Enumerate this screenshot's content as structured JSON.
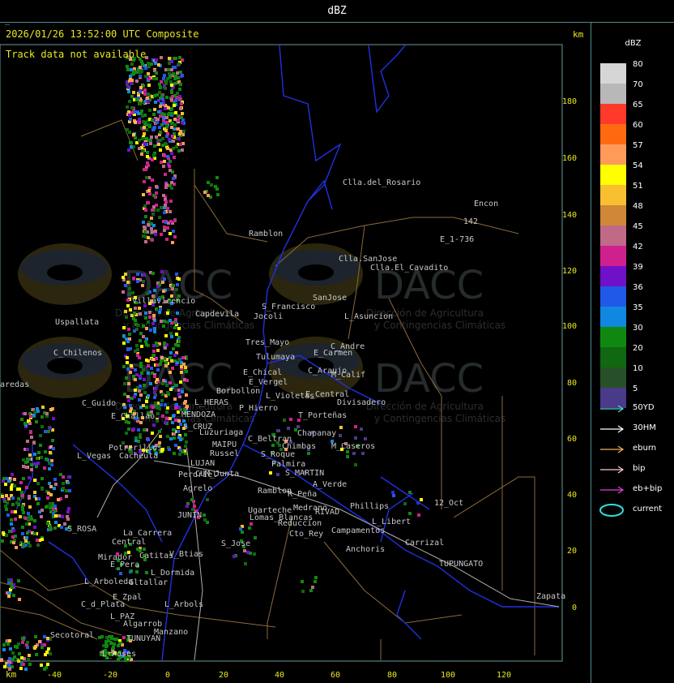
{
  "window": {
    "title": "dBZ"
  },
  "map": {
    "timestamp": "2026/01/26 13:52:00 UTC Composite",
    "track_notice": "Track data not available",
    "units_top": "km",
    "units_bottom": "km",
    "y_ticks": [
      "180",
      "160",
      "140",
      "120",
      "100",
      "80",
      "60",
      "40",
      "20",
      "0"
    ],
    "x_ticks": [
      "-40",
      "-20",
      "0",
      "20",
      "40",
      "60",
      "80",
      "100",
      "120"
    ],
    "watermark": {
      "brand": "DACC",
      "line1": "Dirección de Agricultura",
      "line2": "y Contingencias Climáticas"
    },
    "places": [
      "Clla.del_Rosario",
      "Encon",
      "142",
      "E_1-736",
      "Ramblon",
      "Clla.SanJose",
      "Clla.El_Cavadito",
      "Villavicencio",
      "Capdevila",
      "S_Francisco",
      "SanJose",
      "Uspallata",
      "L_Asuncion",
      "Jocoli",
      "Tres_Mayo",
      "E_Carmen",
      "C_Andre",
      "C_Chilenos",
      "Tulumaya",
      "C_Araujo",
      "M_Calif",
      "E_Chical",
      "E_Vergel",
      "Borbollon",
      "L_Violetas",
      "E_Central",
      "Divisadero",
      "aredas",
      "C_Guido",
      "L_HERAS",
      "P_Hierro",
      "E_Challao",
      "MENDOZA",
      "T_Porteñas",
      "S_CRUZ",
      "Luzuriaga",
      "C_Beltran",
      "Chapanay",
      "Potrerillos",
      "MAIPU",
      "Chimbas",
      "M_Caseros",
      "L_Vegas",
      "Cacheuta",
      "Russel",
      "S_Roque",
      "Palmira",
      "LUJAN",
      "CUM_Junta",
      "Perdriel",
      "S_MARTIN",
      "A_Verde",
      "Agrelo",
      "Ramblon",
      "R_Peña",
      "JUNIN",
      "Ugarteche",
      "Medrano",
      "RIVAD",
      "Phillips",
      "12_Oct",
      "Lomas_Blancas",
      "Reduccion",
      "L_Libert",
      "S_ROSA",
      "La_Carrera",
      "Cto_Rey",
      "Campamentos",
      "Central",
      "S_Jose",
      "Carrizal",
      "Catitas",
      "V_Btias",
      "Anchoris",
      "Mirador",
      "E_Pera",
      "TUPUNGATO",
      "L_Dormida",
      "L_Arboleda",
      "Gltallar",
      "E_Zpal",
      "C_d_Plata",
      "L_Arbols",
      "Zapata",
      "L_PAZ",
      "Algarrob",
      "Secotoral",
      "Manzano",
      "TUNUYAN",
      "L_Roses",
      "V_Flores"
    ]
  },
  "legend": {
    "unit": "dBZ",
    "scale": [
      {
        "label": "80",
        "color": "#d6d6d6"
      },
      {
        "label": "70",
        "color": "#b8b8b8"
      },
      {
        "label": "65",
        "color": "#ff3a2a"
      },
      {
        "label": "60",
        "color": "#ff6a10"
      },
      {
        "label": "57",
        "color": "#ff9a5a"
      },
      {
        "label": "54",
        "color": "#ffff00"
      },
      {
        "label": "51",
        "color": "#f8c030"
      },
      {
        "label": "48",
        "color": "#d08838"
      },
      {
        "label": "45",
        "color": "#c06a88"
      },
      {
        "label": "42",
        "color": "#d0208e"
      },
      {
        "label": "39",
        "color": "#7010c8"
      },
      {
        "label": "36",
        "color": "#2058e8"
      },
      {
        "label": "35",
        "color": "#1088e0"
      },
      {
        "label": "30",
        "color": "#108810"
      },
      {
        "label": "20",
        "color": "#106810"
      },
      {
        "label": "10",
        "color": "#285028"
      },
      {
        "label": "5",
        "color": "#4a3a8a"
      }
    ],
    "tracks": [
      {
        "label": "50YD",
        "color": "#50d8d8"
      },
      {
        "label": "30HM",
        "color": "#ffffff"
      },
      {
        "label": "eburn",
        "color": "#f0b060"
      },
      {
        "label": "bip",
        "color": "#ffc8c8"
      },
      {
        "label": "eb+bip",
        "color": "#e040e0"
      },
      {
        "label": "current",
        "color": "#30e0e0"
      }
    ]
  }
}
